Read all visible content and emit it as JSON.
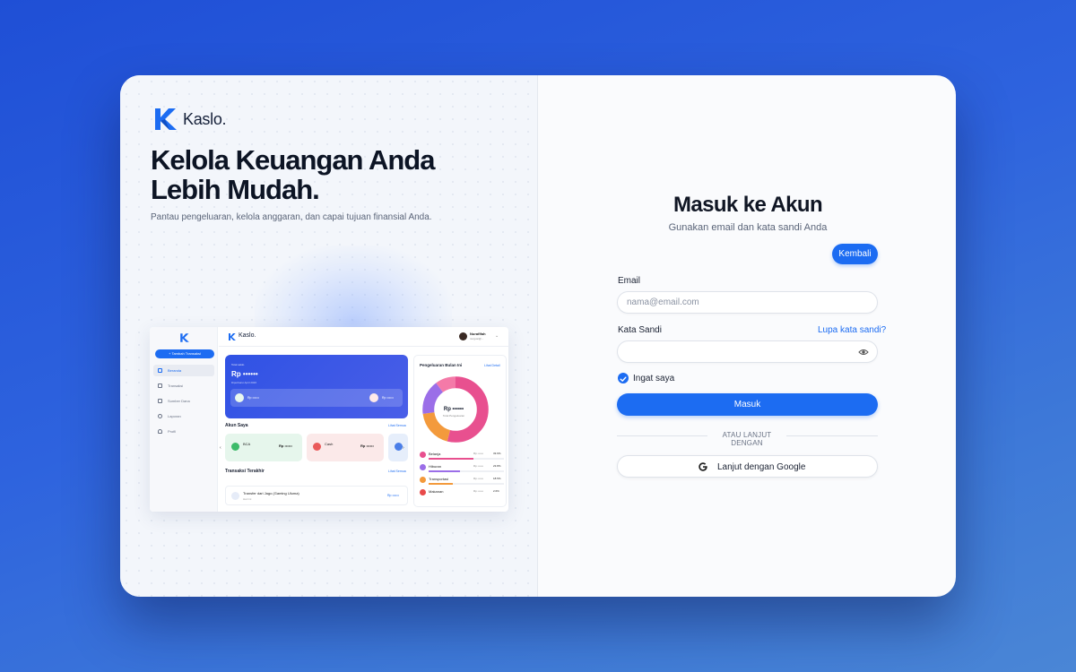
{
  "brand": {
    "name": "Kaslo.",
    "accent": "#1c6cf2"
  },
  "hero": {
    "headline_line1": "Kelola Keuangan Anda",
    "headline_line2": "Lebih Mudah.",
    "subtitle": "Pantau pengeluaran, kelola anggaran, dan capai tujuan finansial Anda."
  },
  "preview": {
    "brand": "Kaslo.",
    "add_button": "+ Tambah Transaksi",
    "nav": [
      {
        "label": "Beranda",
        "icon": "home-icon",
        "active": true
      },
      {
        "label": "Transaksi",
        "icon": "receipt-icon",
        "active": false
      },
      {
        "label": "Sumber Dana",
        "icon": "wallet-icon",
        "active": false
      },
      {
        "label": "Laporan",
        "icon": "chart-icon",
        "active": false
      },
      {
        "label": "Profil",
        "icon": "user-icon",
        "active": false
      }
    ],
    "user": {
      "name": "Nurafifah",
      "email": "nurgusi@..."
    },
    "balance": {
      "label": "Total saldo",
      "value": "Rp ••••••",
      "note": "Diperbarui April 2026",
      "income": "Rp ••••••",
      "expense": "Rp ••••••"
    },
    "accounts_title": "Akun Saya",
    "accounts_link": "Lihat Semua",
    "accounts": [
      {
        "name": "BCA",
        "value": "Rp ••••••",
        "color": "#e6f6ec",
        "dot": "#3dbb6a"
      },
      {
        "name": "Cash",
        "value": "Rp ••••••",
        "color": "#fbe9e9",
        "dot": "#ea5a5a"
      },
      {
        "name": "OVO",
        "value": "",
        "color": "#e6eefb",
        "dot": "#4a7ee8"
      }
    ],
    "trx_title": "Transaksi Terakhir",
    "trx_link": "Lihat Semua",
    "trx": {
      "title": "Transfer dari Jago (Gaming Uluma)",
      "sub": "Hari ini",
      "value": "Rp ••••••"
    },
    "expense_title": "Pengeluaran Bulan Ini",
    "expense_link": "Lihat Detail",
    "expense_center": "Rp ••••••",
    "expense_center_sub": "Total Pengeluaran",
    "expense_rows": [
      {
        "name": "Belanja",
        "value": "Rp ••••••",
        "pct": "33.6%",
        "color": "#e8508f"
      },
      {
        "name": "Hiburan",
        "value": "Rp ••••••",
        "pct": "23.8%",
        "color": "#9b6ee8"
      },
      {
        "name": "Transportasi",
        "value": "Rp ••••••",
        "pct": "18.5%",
        "color": "#f39a3c"
      },
      {
        "name": "Makanan",
        "value": "Rp ••••••",
        "pct": "2.6%",
        "color": "#e84a4a"
      }
    ]
  },
  "form": {
    "title": "Masuk ke Akun",
    "subtitle": "Gunakan email dan kata sandi Anda",
    "back_label": "Kembali",
    "email_label": "Email",
    "email_placeholder": "nama@email.com",
    "password_label": "Kata Sandi",
    "forgot_label": "Lupa kata sandi?",
    "remember_label": "Ingat saya",
    "login_label": "Masuk",
    "divider_label": "ATAU LANJUT DENGAN",
    "google_label": "Lanjut dengan Google"
  }
}
